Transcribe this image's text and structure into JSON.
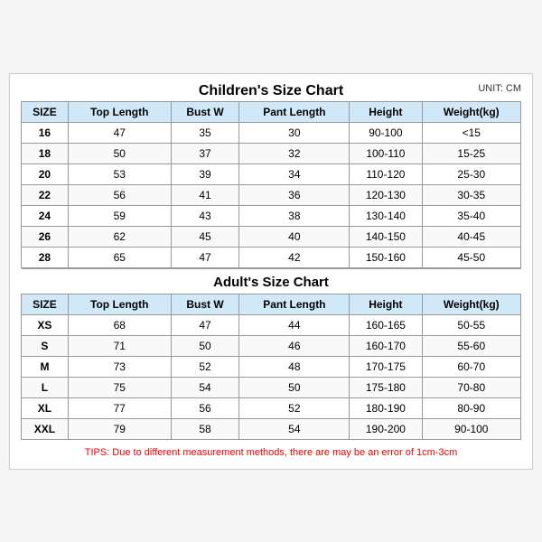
{
  "chart": {
    "main_title": "Children's Size Chart",
    "unit": "UNIT: CM",
    "adult_title": "Adult's Size Chart",
    "tips": "TIPS: Due to different measurement methods, there are may be an error of 1cm-3cm",
    "columns": [
      "SIZE",
      "Top Length",
      "Bust W",
      "Pant Length",
      "Height",
      "Weight(kg)"
    ],
    "children_rows": [
      [
        "16",
        "47",
        "35",
        "30",
        "90-100",
        "<15"
      ],
      [
        "18",
        "50",
        "37",
        "32",
        "100-110",
        "15-25"
      ],
      [
        "20",
        "53",
        "39",
        "34",
        "110-120",
        "25-30"
      ],
      [
        "22",
        "56",
        "41",
        "36",
        "120-130",
        "30-35"
      ],
      [
        "24",
        "59",
        "43",
        "38",
        "130-140",
        "35-40"
      ],
      [
        "26",
        "62",
        "45",
        "40",
        "140-150",
        "40-45"
      ],
      [
        "28",
        "65",
        "47",
        "42",
        "150-160",
        "45-50"
      ]
    ],
    "adult_rows": [
      [
        "XS",
        "68",
        "47",
        "44",
        "160-165",
        "50-55"
      ],
      [
        "S",
        "71",
        "50",
        "46",
        "160-170",
        "55-60"
      ],
      [
        "M",
        "73",
        "52",
        "48",
        "170-175",
        "60-70"
      ],
      [
        "L",
        "75",
        "54",
        "50",
        "175-180",
        "70-80"
      ],
      [
        "XL",
        "77",
        "56",
        "52",
        "180-190",
        "80-90"
      ],
      [
        "XXL",
        "79",
        "58",
        "54",
        "190-200",
        "90-100"
      ]
    ]
  }
}
